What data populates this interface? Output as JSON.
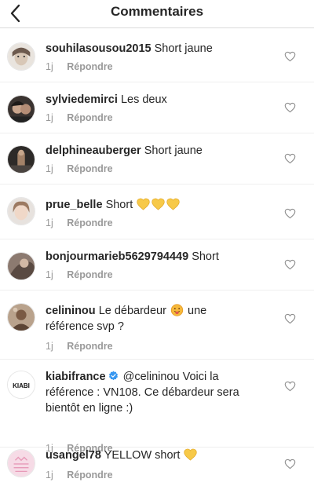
{
  "header": {
    "title": "Commentaires",
    "back_icon": "chevron-left-icon"
  },
  "comments": [
    {
      "username": "souhilasousou2015",
      "text": "Short jaune",
      "time": "1j",
      "reply": "Répondre"
    },
    {
      "username": "sylviedemirci",
      "text": "Les deux",
      "time": "1j",
      "reply": "Répondre"
    },
    {
      "username": "delphineauberger",
      "text": "Short jaune",
      "time": "1j",
      "reply": "Répondre"
    },
    {
      "username": "prue_belle",
      "text": "Short",
      "emoji": "yellow-heart x3",
      "time": "1j",
      "reply": "Répondre"
    },
    {
      "username": "bonjourmarieb5629794449",
      "text": "Short",
      "time": "1j",
      "reply": "Répondre"
    },
    {
      "username": "celininou",
      "text_before": "Le débardeur",
      "emoji": "face-with-tongue",
      "text_after": "une",
      "text_line2": "référence svp ?",
      "time": "1j",
      "reply": "Répondre"
    },
    {
      "username": "kiabifrance",
      "verified": true,
      "text_line1": "@celininou  Voici la",
      "text_line2": "référence : VN108. Ce débardeur sera",
      "text_line3": "bientôt en ligne :)",
      "time": "1j",
      "reply": "Répondre",
      "avatar_text": "KIABI"
    },
    {
      "username": "usangel78",
      "text": "YELLOW short",
      "emoji": "yellow-heart",
      "time": "1j",
      "reply": "Répondre"
    }
  ],
  "colors": {
    "text": "#262626",
    "muted": "#999999",
    "divider": "#efefef",
    "verified": "#3897f0",
    "heart_emoji": "#f7c948"
  }
}
